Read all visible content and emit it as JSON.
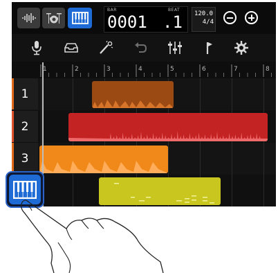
{
  "counter": {
    "bar_label": "BAR",
    "beat_label": "BEAT",
    "bar_value": "0001",
    "beat_value": ".1"
  },
  "tempo": {
    "bpm": "120.0",
    "signature": "4/4"
  },
  "mode_buttons": [
    {
      "icon": "audio-wave-icon",
      "active": false
    },
    {
      "icon": "drum-kit-icon",
      "active": false
    },
    {
      "icon": "piano-icon",
      "active": true
    }
  ],
  "toolbar": [
    {
      "icon": "microphone-icon"
    },
    {
      "icon": "inbox-tray-icon"
    },
    {
      "icon": "wand-icon"
    },
    {
      "icon": "undo-icon"
    },
    {
      "icon": "mixer-faders-icon"
    },
    {
      "icon": "flag-marker-icon"
    },
    {
      "icon": "gear-icon"
    }
  ],
  "ruler": {
    "numbers": [
      "1",
      "2",
      "3",
      "4",
      "5",
      "6",
      "7",
      "8"
    ]
  },
  "tracks": [
    {
      "label": "1",
      "color": "#c0611d"
    },
    {
      "label": "2",
      "color": "#d62b2b"
    },
    {
      "label": "3",
      "color": "#f0891a"
    },
    {
      "label": "",
      "color": "#c8c61f",
      "icon": "piano-icon"
    }
  ],
  "colors": {
    "accent_blue": "#1f6bd6",
    "track1": "#c0611d",
    "track2": "#d62b2b",
    "track3": "#f0891a",
    "track4": "#c8c61f"
  }
}
